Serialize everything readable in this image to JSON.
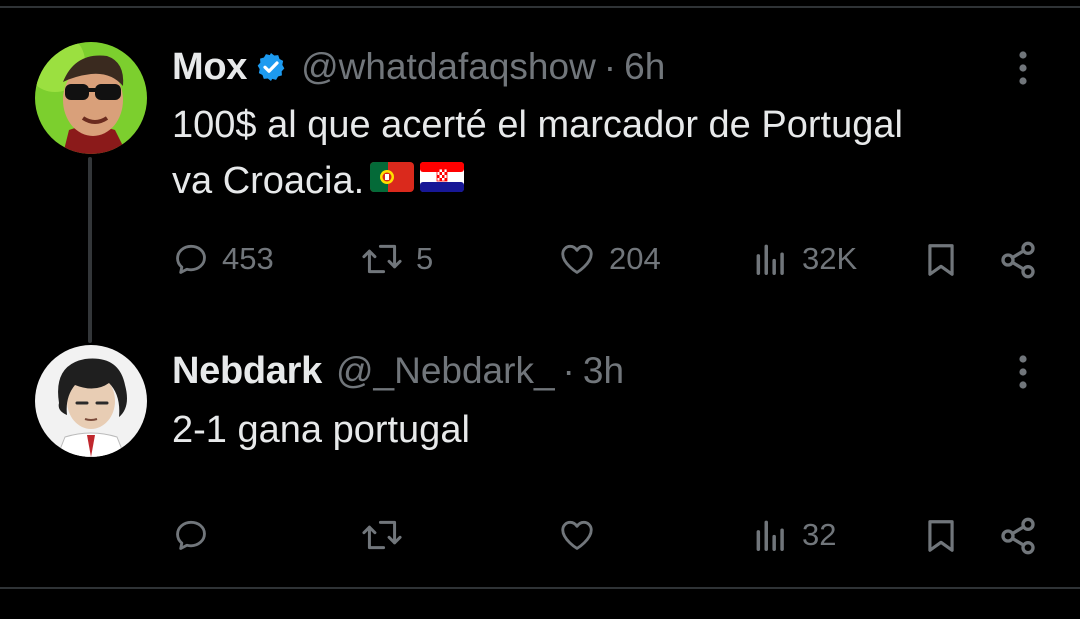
{
  "tweet": {
    "author_name": "Mox",
    "verified": true,
    "handle": "@whatdafaqshow",
    "separator": "·",
    "time": "6h",
    "text_line1": "100$ al que acerté el marcador de Portugal",
    "text_line2": "va Croacia.",
    "flags": [
      "portugal-flag",
      "croatia-flag"
    ],
    "stats": {
      "replies": "453",
      "retweets": "5",
      "likes": "204",
      "views": "32K"
    }
  },
  "reply": {
    "author_name": "Nebdark",
    "handle": "@_Nebdark_",
    "separator": "·",
    "time": "3h",
    "text": "2-1 gana portugal",
    "stats": {
      "views": "32"
    }
  },
  "colors": {
    "background": "#000000",
    "text": "#e7e9ea",
    "muted": "#71767b",
    "verified": "#1d9bf0",
    "divider": "#2f3336"
  }
}
